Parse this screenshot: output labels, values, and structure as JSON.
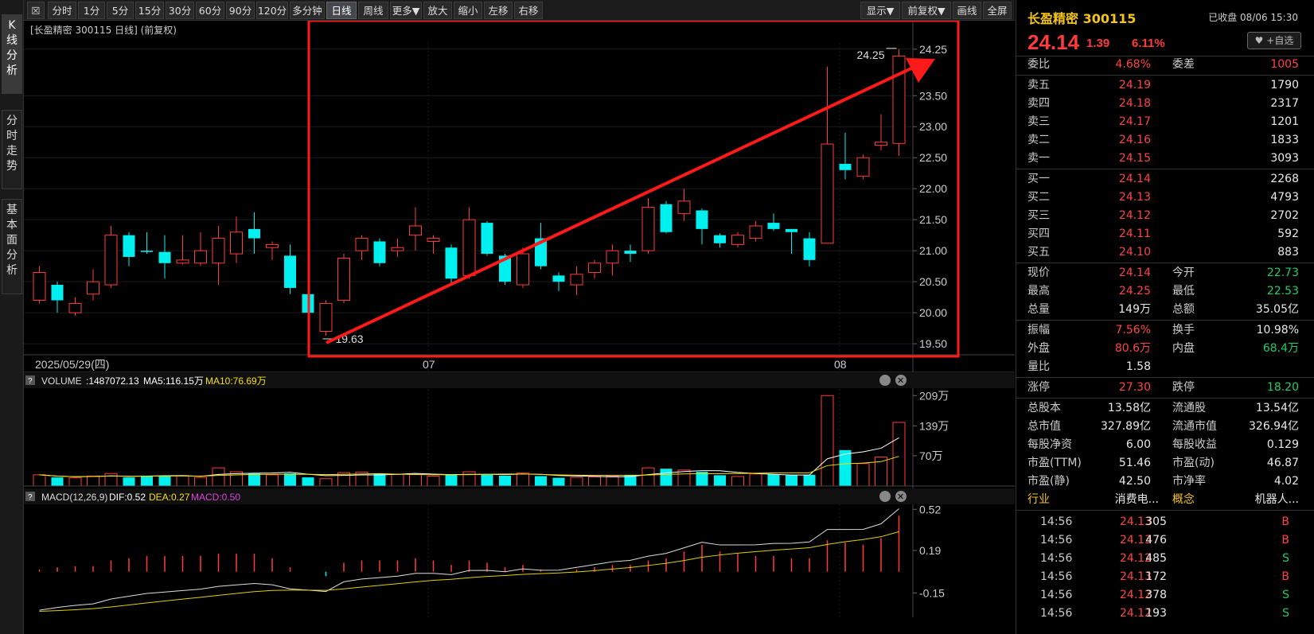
{
  "toolbar": {
    "items": [
      "分时",
      "1分",
      "5分",
      "15分",
      "30分",
      "60分",
      "90分",
      "120分",
      "多分钟",
      "日线",
      "周线",
      "更多▼",
      "放大",
      "缩小",
      "左移",
      "右移"
    ],
    "right_items": [
      "显示▼",
      "前复权▼",
      "画线",
      "全屏"
    ]
  },
  "side_tabs": [
    "K线分析",
    "分时走势",
    "基本面分析"
  ],
  "chart": {
    "title": "[长盈精密 300115 日线] (前复权)",
    "price_ticks": [
      "24.25",
      "23.50",
      "23.00",
      "22.50",
      "22.00",
      "21.50",
      "21.00",
      "20.50",
      "20.00",
      "19.50"
    ],
    "high_label": "24.25",
    "low_label": "19.63",
    "date_labels": [
      "2025/05/29(四)",
      "07",
      "08"
    ],
    "volume_header": {
      "name": "VOLUME",
      "value": ":1487072.13",
      "ma5": "MA5:116.15万",
      "ma10": "MA10:76.69万"
    },
    "volume_ticks": [
      "209万",
      "139万",
      "70万"
    ],
    "macd_header": {
      "name": "MACD(12,26,9)",
      "dif": "DIF:0.52",
      "dea": "DEA:0.27",
      "macd": "MACD:0.50"
    },
    "macd_ticks": [
      "0.52",
      "0.19",
      "-0.15"
    ]
  },
  "chart_data": {
    "type": "candlestick",
    "candles": [
      {
        "o": 20.2,
        "c": 20.65,
        "h": 20.75,
        "l": 20.15
      },
      {
        "o": 20.45,
        "c": 20.2,
        "h": 20.5,
        "l": 20.0
      },
      {
        "o": 20.0,
        "c": 20.15,
        "h": 20.25,
        "l": 19.95
      },
      {
        "o": 20.3,
        "c": 20.5,
        "h": 20.7,
        "l": 20.2
      },
      {
        "o": 20.45,
        "c": 21.25,
        "h": 21.4,
        "l": 20.4
      },
      {
        "o": 21.25,
        "c": 20.9,
        "h": 21.3,
        "l": 20.75
      },
      {
        "o": 21.0,
        "c": 20.98,
        "h": 21.3,
        "l": 20.95
      },
      {
        "o": 20.98,
        "c": 20.8,
        "h": 21.25,
        "l": 20.55
      },
      {
        "o": 20.8,
        "c": 20.85,
        "h": 21.25,
        "l": 20.78
      },
      {
        "o": 20.8,
        "c": 21.0,
        "h": 21.3,
        "l": 20.75
      },
      {
        "o": 20.8,
        "c": 21.2,
        "h": 21.4,
        "l": 20.45
      },
      {
        "o": 20.95,
        "c": 21.3,
        "h": 21.55,
        "l": 20.8
      },
      {
        "o": 21.35,
        "c": 21.2,
        "h": 21.62,
        "l": 20.95
      },
      {
        "o": 21.05,
        "c": 21.1,
        "h": 21.15,
        "l": 20.85
      },
      {
        "o": 20.92,
        "c": 20.4,
        "h": 21.1,
        "l": 20.3
      },
      {
        "o": 20.3,
        "c": 20.0,
        "h": 20.5,
        "l": 20.0
      },
      {
        "o": 19.7,
        "c": 20.15,
        "h": 20.2,
        "l": 19.63
      },
      {
        "o": 20.2,
        "c": 20.88,
        "h": 20.95,
        "l": 20.15
      },
      {
        "o": 21.0,
        "c": 21.2,
        "h": 21.25,
        "l": 20.85
      },
      {
        "o": 21.15,
        "c": 20.8,
        "h": 21.2,
        "l": 20.75
      },
      {
        "o": 21.0,
        "c": 21.05,
        "h": 21.2,
        "l": 20.9
      },
      {
        "o": 21.25,
        "c": 21.4,
        "h": 21.7,
        "l": 21.0
      },
      {
        "o": 21.15,
        "c": 21.2,
        "h": 21.25,
        "l": 20.95
      },
      {
        "o": 21.05,
        "c": 20.55,
        "h": 21.1,
        "l": 20.45
      },
      {
        "o": 20.6,
        "c": 21.5,
        "h": 21.7,
        "l": 20.55
      },
      {
        "o": 21.45,
        "c": 20.95,
        "h": 21.48,
        "l": 20.92
      },
      {
        "o": 20.92,
        "c": 20.5,
        "h": 20.95,
        "l": 20.45
      },
      {
        "o": 20.45,
        "c": 20.95,
        "h": 21.05,
        "l": 20.4
      },
      {
        "o": 21.2,
        "c": 20.75,
        "h": 21.45,
        "l": 20.7
      },
      {
        "o": 20.6,
        "c": 20.5,
        "h": 20.65,
        "l": 20.35
      },
      {
        "o": 20.45,
        "c": 20.62,
        "h": 20.75,
        "l": 20.28
      },
      {
        "o": 20.65,
        "c": 20.8,
        "h": 20.85,
        "l": 20.55
      },
      {
        "o": 20.8,
        "c": 21.0,
        "h": 21.1,
        "l": 20.6
      },
      {
        "o": 21.0,
        "c": 20.95,
        "h": 21.1,
        "l": 20.82
      },
      {
        "o": 21.0,
        "c": 21.7,
        "h": 21.85,
        "l": 20.95
      },
      {
        "o": 21.75,
        "c": 21.3,
        "h": 21.8,
        "l": 21.28
      },
      {
        "o": 21.6,
        "c": 21.8,
        "h": 22.0,
        "l": 21.48
      },
      {
        "o": 21.65,
        "c": 21.35,
        "h": 21.68,
        "l": 21.1
      },
      {
        "o": 21.25,
        "c": 21.12,
        "h": 21.28,
        "l": 21.05
      },
      {
        "o": 21.1,
        "c": 21.25,
        "h": 21.3,
        "l": 21.05
      },
      {
        "o": 21.2,
        "c": 21.4,
        "h": 21.48,
        "l": 21.15
      },
      {
        "o": 21.45,
        "c": 21.35,
        "h": 21.6,
        "l": 21.32
      },
      {
        "o": 21.35,
        "c": 21.3,
        "h": 21.35,
        "l": 20.95
      },
      {
        "o": 21.2,
        "c": 20.85,
        "h": 21.3,
        "l": 20.75
      },
      {
        "o": 21.12,
        "c": 22.72,
        "h": 23.97,
        "l": 21.12
      },
      {
        "o": 22.4,
        "c": 22.3,
        "h": 22.9,
        "l": 22.15
      },
      {
        "o": 22.2,
        "c": 22.5,
        "h": 22.55,
        "l": 22.15
      },
      {
        "o": 22.7,
        "c": 22.75,
        "h": 23.2,
        "l": 22.62
      },
      {
        "o": 22.73,
        "c": 24.14,
        "h": 24.25,
        "l": 22.53
      }
    ],
    "volume_wan": [
      26,
      20,
      19,
      23,
      29,
      20,
      24,
      24,
      24,
      20,
      42,
      33,
      29,
      26,
      29,
      20,
      17,
      31,
      32,
      29,
      27,
      27,
      23,
      26,
      33,
      26,
      24,
      30,
      23,
      19,
      20,
      21,
      23,
      26,
      42,
      40,
      37,
      33,
      25,
      22,
      28,
      27,
      25,
      26,
      209,
      83,
      52,
      67,
      147
    ],
    "macd_hist": [
      0.02,
      0.04,
      0.05,
      0.05,
      0.1,
      0.12,
      0.14,
      0.14,
      0.14,
      0.14,
      0.16,
      0.16,
      0.16,
      0.12,
      0.04,
      0.0,
      -0.04,
      0.08,
      0.1,
      0.1,
      0.1,
      0.12,
      0.1,
      0.06,
      0.1,
      0.08,
      0.04,
      0.06,
      0.02,
      0.0,
      0.02,
      0.04,
      0.06,
      0.06,
      0.1,
      0.12,
      0.18,
      0.24,
      0.18,
      0.16,
      0.14,
      0.14,
      0.12,
      0.12,
      0.28,
      0.26,
      0.24,
      0.3,
      0.5
    ],
    "price_range": [
      19.5,
      24.25
    ]
  },
  "quote": {
    "name": "长盈精密 300115",
    "status": "已收盘 08/06 15:30",
    "price": "24.14",
    "change": "1.39",
    "pct": "6.11%",
    "fav_label": "+自选",
    "weibi": {
      "l1": "委比",
      "v1": "4.68%",
      "l2": "委差",
      "v2": "1005"
    },
    "asks": [
      {
        "label": "卖五",
        "price": "24.19",
        "vol": "1790"
      },
      {
        "label": "卖四",
        "price": "24.18",
        "vol": "2317"
      },
      {
        "label": "卖三",
        "price": "24.17",
        "vol": "1201"
      },
      {
        "label": "卖二",
        "price": "24.16",
        "vol": "1833"
      },
      {
        "label": "卖一",
        "price": "24.15",
        "vol": "3093"
      }
    ],
    "bids": [
      {
        "label": "买一",
        "price": "24.14",
        "vol": "2268"
      },
      {
        "label": "买二",
        "price": "24.13",
        "vol": "4793"
      },
      {
        "label": "买三",
        "price": "24.12",
        "vol": "2702"
      },
      {
        "label": "买四",
        "price": "24.11",
        "vol": "592"
      },
      {
        "label": "买五",
        "price": "24.10",
        "vol": "883"
      }
    ],
    "stats1": [
      {
        "l1": "现价",
        "v1": "24.14",
        "c1": "red",
        "l2": "今开",
        "v2": "22.73",
        "c2": "green"
      },
      {
        "l1": "最高",
        "v1": "24.25",
        "c1": "red",
        "l2": "最低",
        "v2": "22.53",
        "c2": "green"
      },
      {
        "l1": "总量",
        "v1": "149万",
        "c1": "white",
        "l2": "总额",
        "v2": "35.05亿",
        "c2": "white"
      }
    ],
    "stats2": [
      {
        "l1": "振幅",
        "v1": "7.56%",
        "c1": "red",
        "l2": "换手",
        "v2": "10.98%",
        "c2": "white"
      },
      {
        "l1": "外盘",
        "v1": "80.6万",
        "c1": "red",
        "l2": "内盘",
        "v2": "68.4万",
        "c2": "green"
      },
      {
        "l1": "量比",
        "v1": "1.58",
        "c1": "white",
        "l2": "",
        "v2": "",
        "c2": "white"
      }
    ],
    "limits": {
      "l1": "涨停",
      "v1": "27.30",
      "l2": "跌停",
      "v2": "18.20"
    },
    "stats3": [
      {
        "l1": "总股本",
        "v1": "13.58亿",
        "l2": "流通股",
        "v2": "13.54亿"
      },
      {
        "l1": "总市值",
        "v1": "327.89亿",
        "l2": "流通市值",
        "v2": "326.94亿"
      },
      {
        "l1": "每股净资",
        "v1": "6.00",
        "l2": "每股收益",
        "v2": "0.129"
      },
      {
        "l1": "市盈(TTM)",
        "v1": "51.46",
        "l2": "市盈(动)",
        "v2": "46.87"
      },
      {
        "l1": "市盈(静)",
        "v1": "42.50",
        "l2": "市净率",
        "v2": "4.02"
      }
    ],
    "industry": {
      "l1": "行业",
      "v1": "消费电...",
      "l2": "概念",
      "v2": "机器人..."
    },
    "trades": [
      {
        "time": "14:56",
        "price": "24.13",
        "vol": "305",
        "side": "B"
      },
      {
        "time": "14:56",
        "price": "24.13",
        "vol": "476",
        "side": "B"
      },
      {
        "time": "14:56",
        "price": "24.12",
        "vol": "485",
        "side": "S"
      },
      {
        "time": "14:56",
        "price": "24.13",
        "vol": "172",
        "side": "B"
      },
      {
        "time": "14:56",
        "price": "24.12",
        "vol": "378",
        "side": "S"
      },
      {
        "time": "14:56",
        "price": "24.12",
        "vol": "193",
        "side": "S"
      }
    ]
  }
}
